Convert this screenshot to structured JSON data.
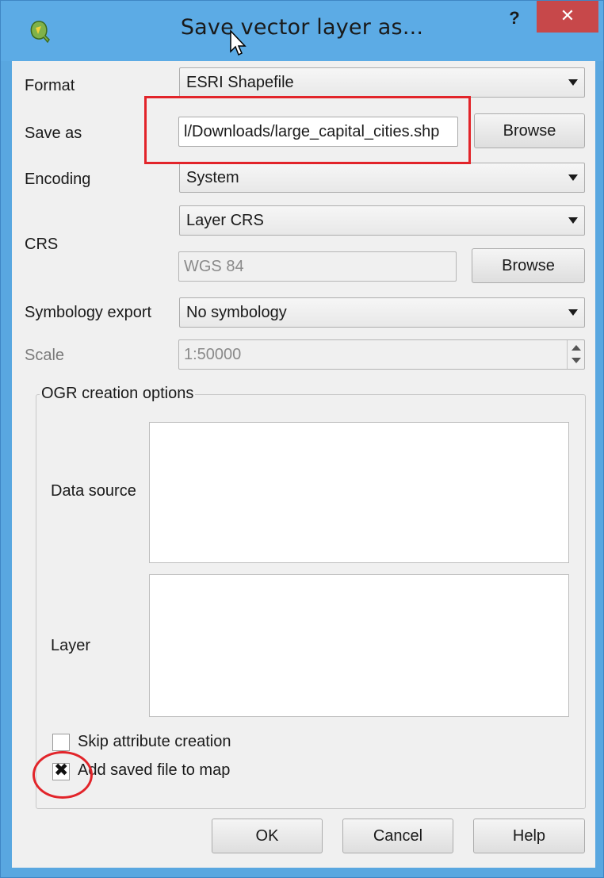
{
  "window": {
    "title": "Save vector layer as...",
    "help_glyph": "?",
    "close_glyph": "✕"
  },
  "format": {
    "label": "Format",
    "value": "ESRI Shapefile"
  },
  "save_as": {
    "label": "Save as",
    "value": "l/Downloads/large_capital_cities.shp",
    "browse_label": "Browse"
  },
  "encoding": {
    "label": "Encoding",
    "value": "System"
  },
  "crs": {
    "label": "CRS",
    "mode_value": "Layer CRS",
    "crs_value": "WGS 84",
    "browse_label": "Browse"
  },
  "symbology": {
    "label": "Symbology export",
    "value": "No symbology"
  },
  "scale": {
    "label": "Scale",
    "value": "1:50000"
  },
  "ogr": {
    "title": "OGR creation options",
    "data_source_label": "Data source",
    "layer_label": "Layer"
  },
  "options": {
    "skip_attr_label": "Skip attribute creation",
    "skip_attr_checked": false,
    "add_to_map_label": "Add saved file to map",
    "add_to_map_checked": true,
    "check_glyph": "✖"
  },
  "buttons": {
    "ok": "OK",
    "cancel": "Cancel",
    "help": "Help"
  },
  "colors": {
    "titlebar": "#5cabe5",
    "close_button": "#c7484a",
    "annotation_red": "#e2242a"
  }
}
